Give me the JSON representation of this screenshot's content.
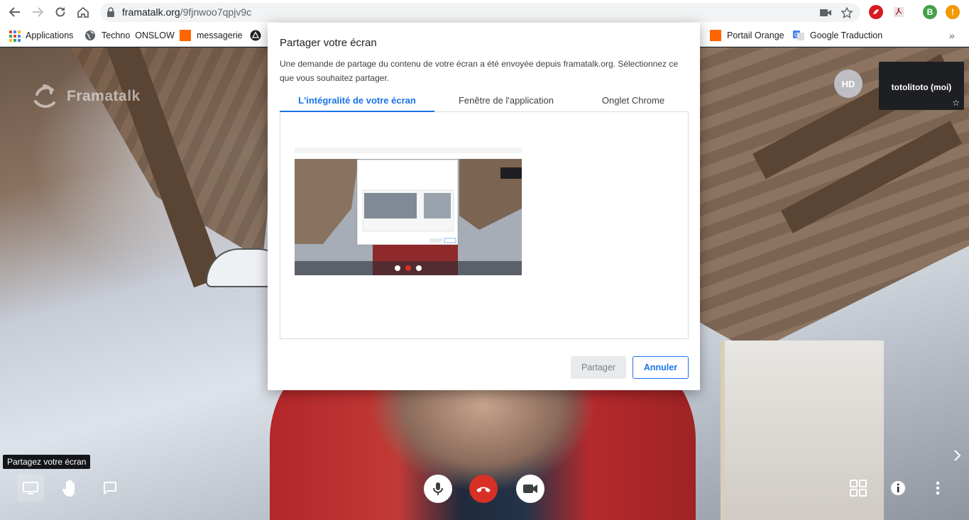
{
  "browser": {
    "url_host": "framatalk.org",
    "url_path": "/9fjnwoo7qpjv9c",
    "profile_initial": "B"
  },
  "bookmarks": [
    {
      "label": "Applications",
      "icon": "apps-grid-icon"
    },
    {
      "label": "Techno  ONSLOW",
      "icon": "globe-icon"
    },
    {
      "label": "messagerie",
      "icon": "orange-icon"
    },
    {
      "label": "Portail Orange",
      "icon": "orange-icon"
    },
    {
      "label": "Google Traduction",
      "icon": "translate-icon"
    }
  ],
  "video": {
    "watermark": "Framatalk",
    "remote_badge": "HD",
    "self_name": "totolitoto (moi)"
  },
  "toolbar": {
    "tooltip": "Partagez votre écran"
  },
  "dialog": {
    "title": "Partager votre écran",
    "description": "Une demande de partage du contenu de votre écran a été envoyée depuis framatalk.org. Sélectionnez ce que vous souhaitez partager.",
    "tabs": [
      {
        "label": "L'intégralité de votre écran",
        "active": true
      },
      {
        "label": "Fenêtre de l'application",
        "active": false
      },
      {
        "label": "Onglet Chrome",
        "active": false
      }
    ],
    "share_button": "Partager",
    "cancel_button": "Annuler"
  },
  "colors": {
    "accent": "#1a73e8",
    "hangup": "#d93025",
    "orange": "#ff6600"
  }
}
